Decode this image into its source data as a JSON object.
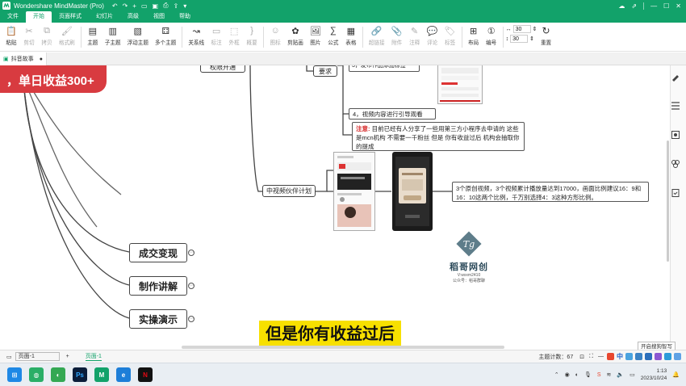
{
  "window": {
    "title": "Wondershare MindMaster (Pro)",
    "brand_color": "#12a26a"
  },
  "menu": {
    "items": [
      "文件",
      "开始",
      "页面样式",
      "幻灯片",
      "高级",
      "视图",
      "帮助"
    ],
    "active_index": 1
  },
  "toolbar": {
    "groups": [
      [
        {
          "label": "粘贴",
          "icon": "paste-icon",
          "enabled": true
        },
        {
          "label": "剪切",
          "icon": "cut-icon",
          "enabled": false
        },
        {
          "label": "拷贝",
          "icon": "copy-icon",
          "enabled": false
        },
        {
          "label": "格式刷",
          "icon": "format-painter-icon",
          "enabled": false
        }
      ],
      [
        {
          "label": "主题",
          "icon": "topic-icon",
          "enabled": true
        },
        {
          "label": "子主题",
          "icon": "subtopic-icon",
          "enabled": true
        },
        {
          "label": "浮动主题",
          "icon": "floating-topic-icon",
          "enabled": true
        },
        {
          "label": "多个主题",
          "icon": "multiple-topics-icon",
          "enabled": true
        }
      ],
      [
        {
          "label": "关系线",
          "icon": "relationship-icon",
          "enabled": true
        },
        {
          "label": "标注",
          "icon": "callout-icon",
          "enabled": false
        },
        {
          "label": "外框",
          "icon": "boundary-icon",
          "enabled": false
        },
        {
          "label": "概要",
          "icon": "summary-icon",
          "enabled": false
        }
      ],
      [
        {
          "label": "图标",
          "icon": "mark-icon",
          "enabled": false
        },
        {
          "label": "剪贴画",
          "icon": "clipart-icon",
          "enabled": true
        },
        {
          "label": "图片",
          "icon": "picture-icon",
          "enabled": true
        },
        {
          "label": "公式",
          "icon": "formula-icon",
          "enabled": true
        },
        {
          "label": "表格",
          "icon": "table-icon",
          "enabled": true
        }
      ],
      [
        {
          "label": "超链接",
          "icon": "hyperlink-icon",
          "enabled": false
        },
        {
          "label": "附件",
          "icon": "attachment-icon",
          "enabled": false
        },
        {
          "label": "注释",
          "icon": "note-icon",
          "enabled": false
        },
        {
          "label": "评论",
          "icon": "comment-icon",
          "enabled": false
        },
        {
          "label": "标签",
          "icon": "tag-icon",
          "enabled": false
        }
      ],
      [
        {
          "label": "布局",
          "icon": "layout-icon",
          "enabled": true
        },
        {
          "label": "编号",
          "icon": "numbering-icon",
          "enabled": true
        }
      ]
    ],
    "spacing_values": [
      "30",
      "30"
    ],
    "reset_label": "重置"
  },
  "doc_tab": {
    "label": "抖音故事"
  },
  "canvas": {
    "banner_text": "，单日收益300+",
    "nodes": {
      "top_cut": "权限开通",
      "requirement": "要求",
      "item3": "3，发布作品添加标签",
      "item4": "4，视频内容进行引导观看",
      "note_label": "注意:",
      "note_text": "目前已经有人分享了一些用第三方小程序去申请的 这些是mcn机构 不需要一千粉丝 但是 你有收益过后 机构会抽取你的提成",
      "program": "中视频伙伴计划",
      "program_desc": "3个原创视频，3个视频累计播放量达到17000，画面比例建议16：9和16：10这两个比例，千万别选择4：3这种方形比例。",
      "deal": "成交变现",
      "explain": "制作讲解",
      "demo": "实操演示"
    },
    "logo": {
      "name": "稻哥网创",
      "sub1": "V:wxxm2410",
      "sub2": "公众号：稻哥群聊"
    },
    "subtitle": "但是你有收益过后"
  },
  "statusbar": {
    "page_select": "页面-1",
    "page_tab": "页面-1",
    "topic_count_label": "主题计数：",
    "topic_count": "67",
    "popup": "开启搜狗智写"
  },
  "ime": {
    "label": "中"
  },
  "taskbar": {
    "apps": [
      "windows-icon",
      "wechat-icon",
      "browser-icon",
      "photoshop-icon",
      "mindmaster-icon",
      "edge-icon",
      "netflix-icon"
    ],
    "time": "1:13",
    "date": "2023/10/24"
  }
}
